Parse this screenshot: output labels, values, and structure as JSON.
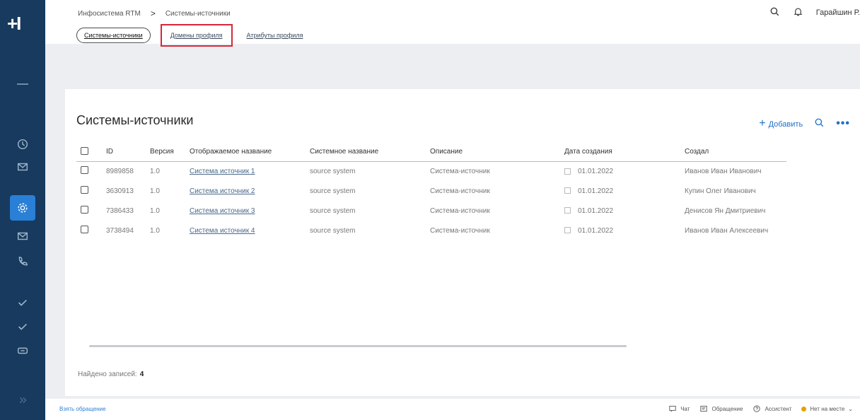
{
  "app": {
    "logo": "+I"
  },
  "breadcrumb": {
    "items": [
      "Инфосистема RTM",
      "Системы-источники"
    ],
    "separator": ">"
  },
  "header": {
    "user": "Гарайшин Р."
  },
  "tabs": [
    {
      "label": "Системы-источники",
      "active": true
    },
    {
      "label": "Домены профиля",
      "highlighted": true
    },
    {
      "label": "Атрибуты профиля"
    }
  ],
  "page": {
    "title": "Системы-источники",
    "add_label": "Добавить",
    "found_label": "Найдено записей:",
    "found_count": "4"
  },
  "table": {
    "columns": [
      "ID",
      "Версия",
      "Отображаемое название",
      "Системное название",
      "Описание",
      "Дата создания",
      "Создал"
    ],
    "rows": [
      [
        "8989858",
        "1.0",
        "Система источник 1",
        "source system",
        "Система-источник",
        "01.01.2022",
        "Иванов Иван Иванович"
      ],
      [
        "3630913",
        "1.0",
        "Система источник 2",
        "source system",
        "Система-источник",
        "01.01.2022",
        "Купин Олег Иванович"
      ],
      [
        "7386433",
        "1.0",
        "Система источник 3",
        "source system",
        "Система-источник",
        "01.01.2022",
        "Денисов Ян Дмитриевич"
      ],
      [
        "3738494",
        "1.0",
        "Система источник 4",
        "source system",
        "Система-источник",
        "01.01.2022",
        "Иванов Иван Алексеевич"
      ]
    ]
  },
  "footer": {
    "take_request": "Взять обращение",
    "chat": "Чат",
    "requests": "Обращение",
    "assistant": "Ассистент",
    "status": "Нет на месте"
  },
  "colors": {
    "rail": "#173a5e",
    "accent": "#2a7fd6",
    "highlight": "#d6283a",
    "status": "#e6a100"
  }
}
